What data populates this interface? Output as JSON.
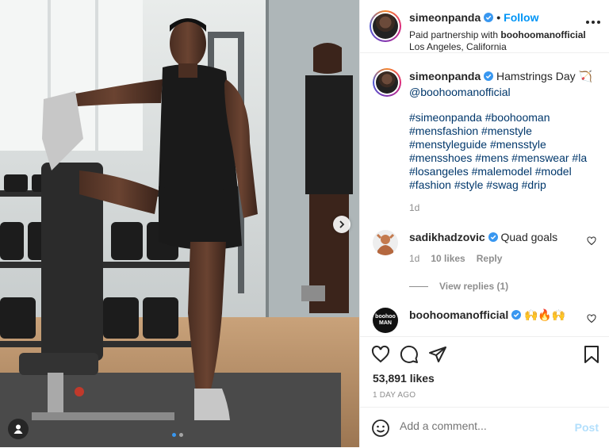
{
  "post": {
    "username": "simeonpanda",
    "follow_label": "Follow",
    "partnership_prefix": "Paid partnership with ",
    "partner": "boohoomanofficial",
    "location": "Los Angeles, California"
  },
  "caption": {
    "username": "simeonpanda",
    "text": "Hamstrings Day 🏹",
    "mention": "@boohoomanofficial",
    "hashtag_lines": [
      "#simeonpanda #boohooman",
      "#mensfashion #menstyle",
      "#menstyleguide #mensstyle",
      "#mensshoes #mens #menswear #la",
      "#losangeles #malemodel #model",
      "#fashion #style #swag #drip"
    ],
    "time": "1d"
  },
  "comments": [
    {
      "username": "sadikhadzovic",
      "text": "Quad goals",
      "time": "1d",
      "likes": "10 likes",
      "reply_label": "Reply",
      "view_replies": "View replies (1)"
    },
    {
      "username": "boohoomanofficial",
      "text": "🙌🔥🙌",
      "avatar_text": "boohoo MAN"
    }
  ],
  "stats": {
    "likes": "53,891 likes",
    "date": "1 DAY AGO"
  },
  "add_comment": {
    "placeholder": "Add a comment...",
    "post_label": "Post"
  },
  "icons": {
    "like": "heart-icon",
    "comment": "comment-icon",
    "share": "share-icon",
    "save": "bookmark-icon",
    "emoji": "smiley-icon",
    "verified": "verified-badge-icon",
    "more": "more-options-icon",
    "next": "chevron-right-icon",
    "tagged": "user-tag-icon"
  },
  "colors": {
    "link": "#00376b",
    "follow": "#0095f6",
    "verified": "#3897f0",
    "muted": "#8e8e8e",
    "post_disabled": "#b2dffc"
  }
}
